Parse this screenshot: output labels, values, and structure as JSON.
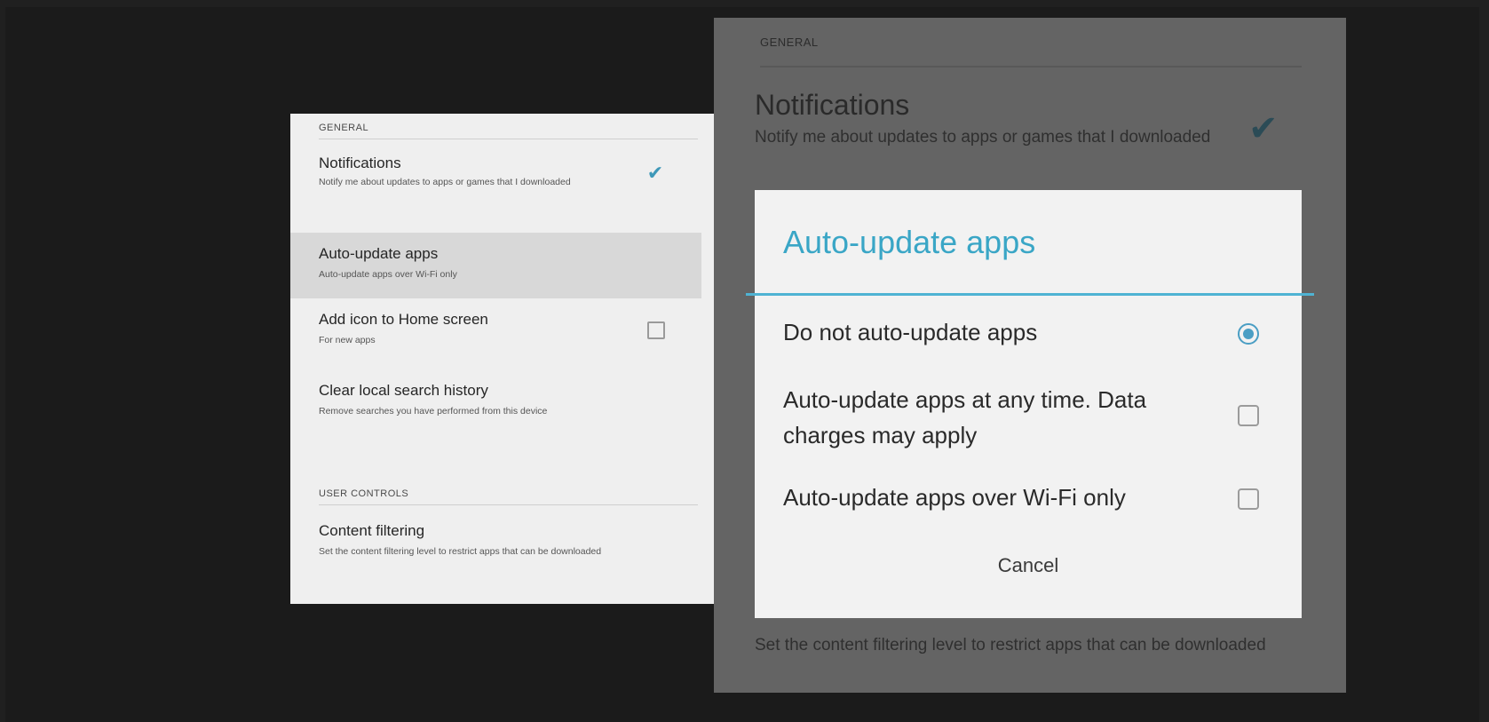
{
  "left_panel": {
    "sections": {
      "general": "GENERAL",
      "user_controls": "USER CONTROLS"
    },
    "items": [
      {
        "title": "Notifications",
        "subtitle": "Notify me about updates to apps or games that I downloaded",
        "control": "checkbox",
        "checked": true
      },
      {
        "title": "Auto-update apps",
        "subtitle": "Auto-update apps over Wi-Fi only",
        "control": "none"
      },
      {
        "title": "Add icon to Home screen",
        "subtitle": "For new apps",
        "control": "checkbox",
        "checked": false
      },
      {
        "title": "Clear local search history",
        "subtitle": "Remove searches you have performed from this device",
        "control": "none"
      },
      {
        "title": "Content filtering",
        "subtitle": "Set the content filtering level to restrict apps that can be downloaded",
        "control": "none"
      }
    ]
  },
  "right_panel": {
    "section": "GENERAL",
    "notifications_title": "Notifications",
    "notifications_subtitle": "Notify me about updates to apps or games that I downloaded",
    "bottom_text": "Set the content filtering level to restrict apps that can be downloaded"
  },
  "dialog": {
    "title": "Auto-update apps",
    "options": [
      {
        "label": "Do not auto-update apps",
        "selected": true
      },
      {
        "label": "Auto-update apps at any time. Data charges may apply",
        "selected": false
      },
      {
        "label": "Auto-update apps over Wi-Fi only",
        "selected": false
      }
    ],
    "cancel_label": "Cancel"
  },
  "colors": {
    "accent": "#3aa6c6",
    "checkbox_accent": "#4a9ec4",
    "background": "#1b1b1b",
    "panel": "#efefef",
    "dimmed_panel": "#646464"
  },
  "icons": {
    "check": "check-icon",
    "radio_selected": "radio-selected-icon",
    "radio_unselected": "radio-unselected-icon"
  }
}
